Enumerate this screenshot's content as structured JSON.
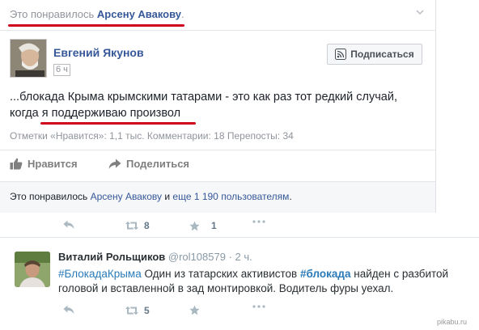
{
  "fb": {
    "liked_prefix": "Это понравилось ",
    "liked_name": "Арсену Авакову",
    "liked_suffix": ".",
    "author": "Евгений Якунов",
    "time": "6 ч",
    "subscribe_label": "Подписаться",
    "post_line1": "...блокада Крыма крымскими татарами - это как раз тот редкий случай,",
    "post_line2": "когда я поддерживаю произвол",
    "stats": "Отметки «Нравится»: 1,1 тыс.   Комментарии: 18   Перепосты: 34",
    "like_label": "Нравится",
    "share_label": "Поделиться",
    "bottom_prefix": "Это понравилось ",
    "bottom_name": "Арсену Авакову",
    "bottom_mid": " и ",
    "bottom_others": "еще 1 190 пользователям",
    "bottom_suffix": "."
  },
  "tw1": {
    "retweets": "8",
    "favorites": "1"
  },
  "tw2": {
    "name": "Виталий Рольщиков",
    "handle": "@rol108579 · 2 ч.",
    "tag1": "#БлокадаКрыма",
    "text1": " Один из татарских активистов ",
    "tag2": "#блокада",
    "text2": " найден с разбитой головой и вставленной в зад монтировкой. Водитель фуры уехал.",
    "retweets": "5"
  },
  "watermark": "pikabu.ru",
  "colors": {
    "link": "#365899",
    "underline": "#d0021b",
    "tw_link": "#2b7bb9"
  }
}
